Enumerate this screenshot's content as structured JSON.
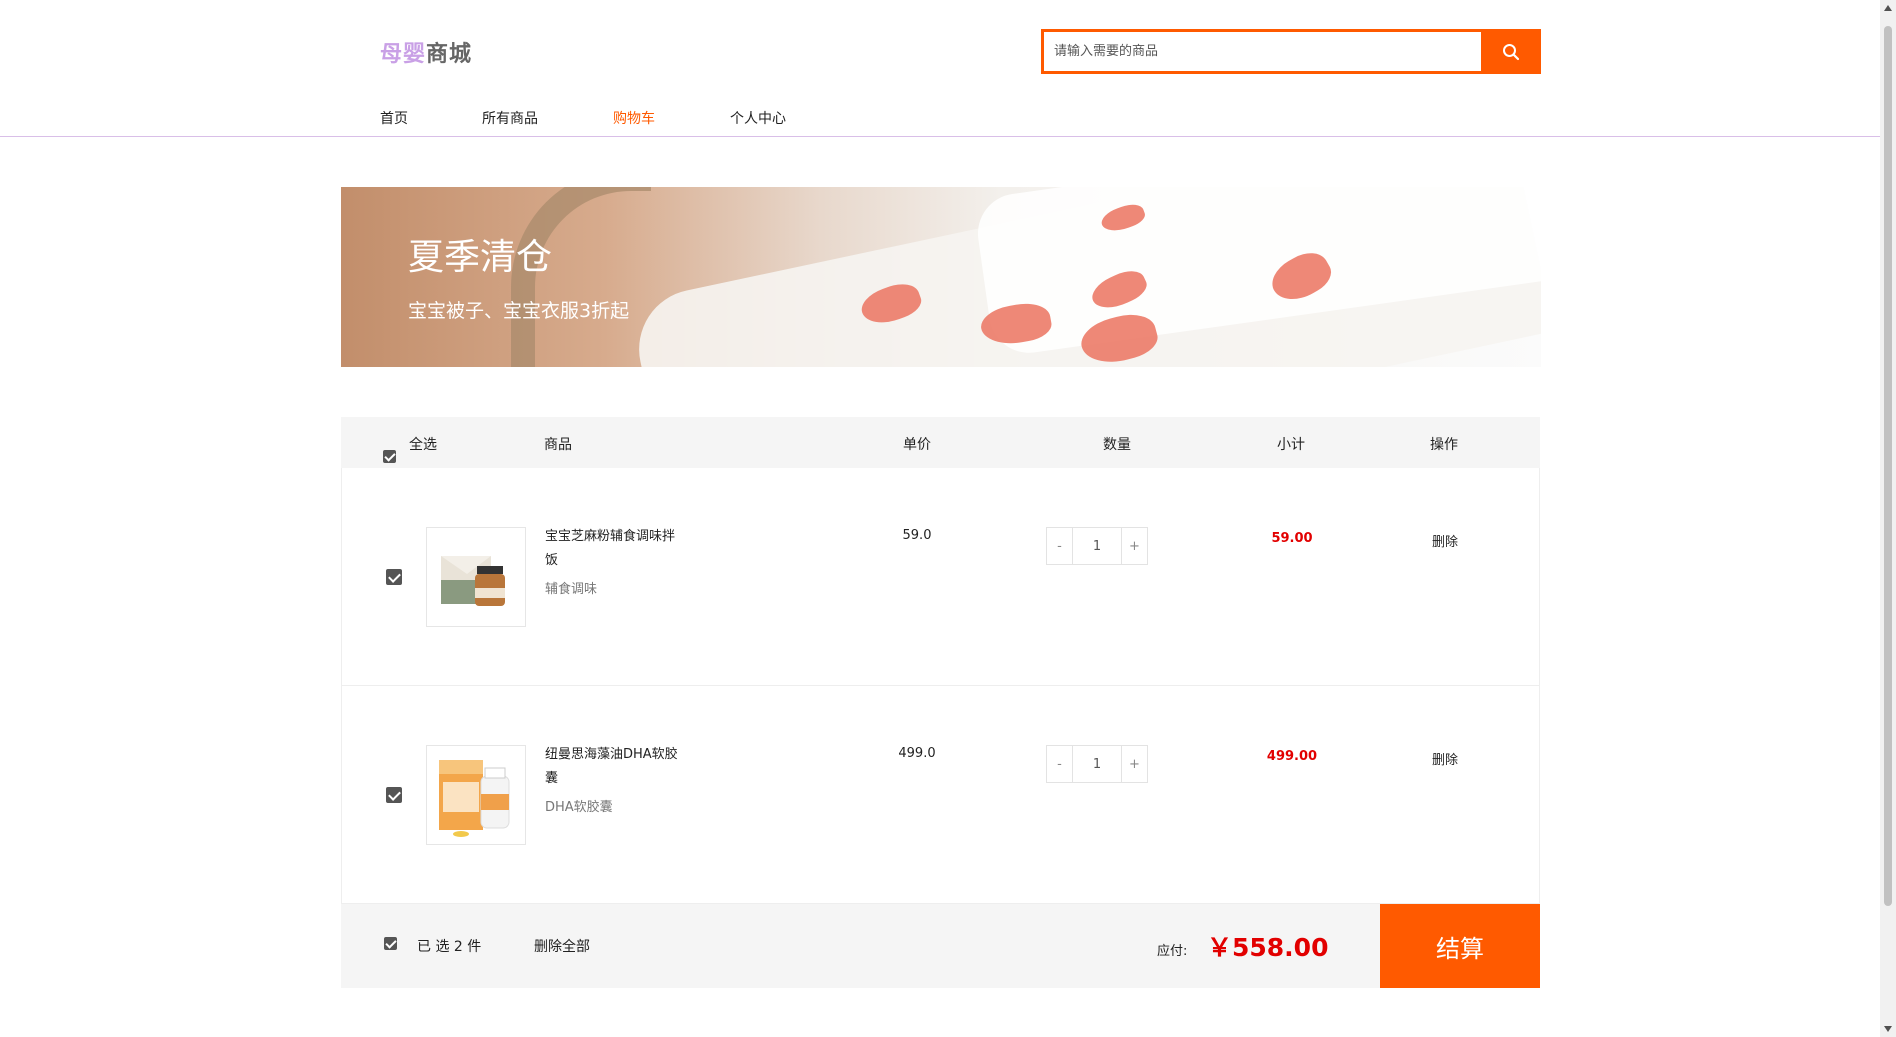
{
  "header": {
    "logo_brand": "母婴",
    "logo_mall": "商城",
    "search_placeholder": "请输入需要的商品"
  },
  "nav": {
    "items": [
      {
        "label": "首页"
      },
      {
        "label": "所有商品"
      },
      {
        "label": "购物车"
      },
      {
        "label": "个人中心"
      }
    ],
    "active_index": 2
  },
  "banner": {
    "title": "夏季清仓",
    "subtitle": "宝宝被子、宝宝衣服3折起"
  },
  "cart": {
    "headers": {
      "select_all": "全选",
      "product": "商品",
      "unit_price": "单价",
      "quantity": "数量",
      "subtotal": "小计",
      "action": "操作"
    },
    "items": [
      {
        "name": "宝宝芝麻粉辅食调味拌饭",
        "category": "辅食调味",
        "price": "59.0",
        "qty": "1",
        "subtotal": "59.00",
        "delete": "删除",
        "checked": true
      },
      {
        "name": "纽曼思海藻油DHA软胶囊",
        "category": "DHA软胶囊",
        "price": "499.0",
        "qty": "1",
        "subtotal": "499.00",
        "delete": "删除",
        "checked": true
      }
    ],
    "qty_minus": "-",
    "qty_plus": "+",
    "footer": {
      "selected": "已 选 2 件",
      "delete_all": "删除全部",
      "payable_label": "应付:",
      "total": "￥558.00",
      "checkout": "结算"
    }
  },
  "colors": {
    "accent": "#ff5a00",
    "price_red": "#e20000",
    "logo_purple": "#c9a0e6"
  }
}
